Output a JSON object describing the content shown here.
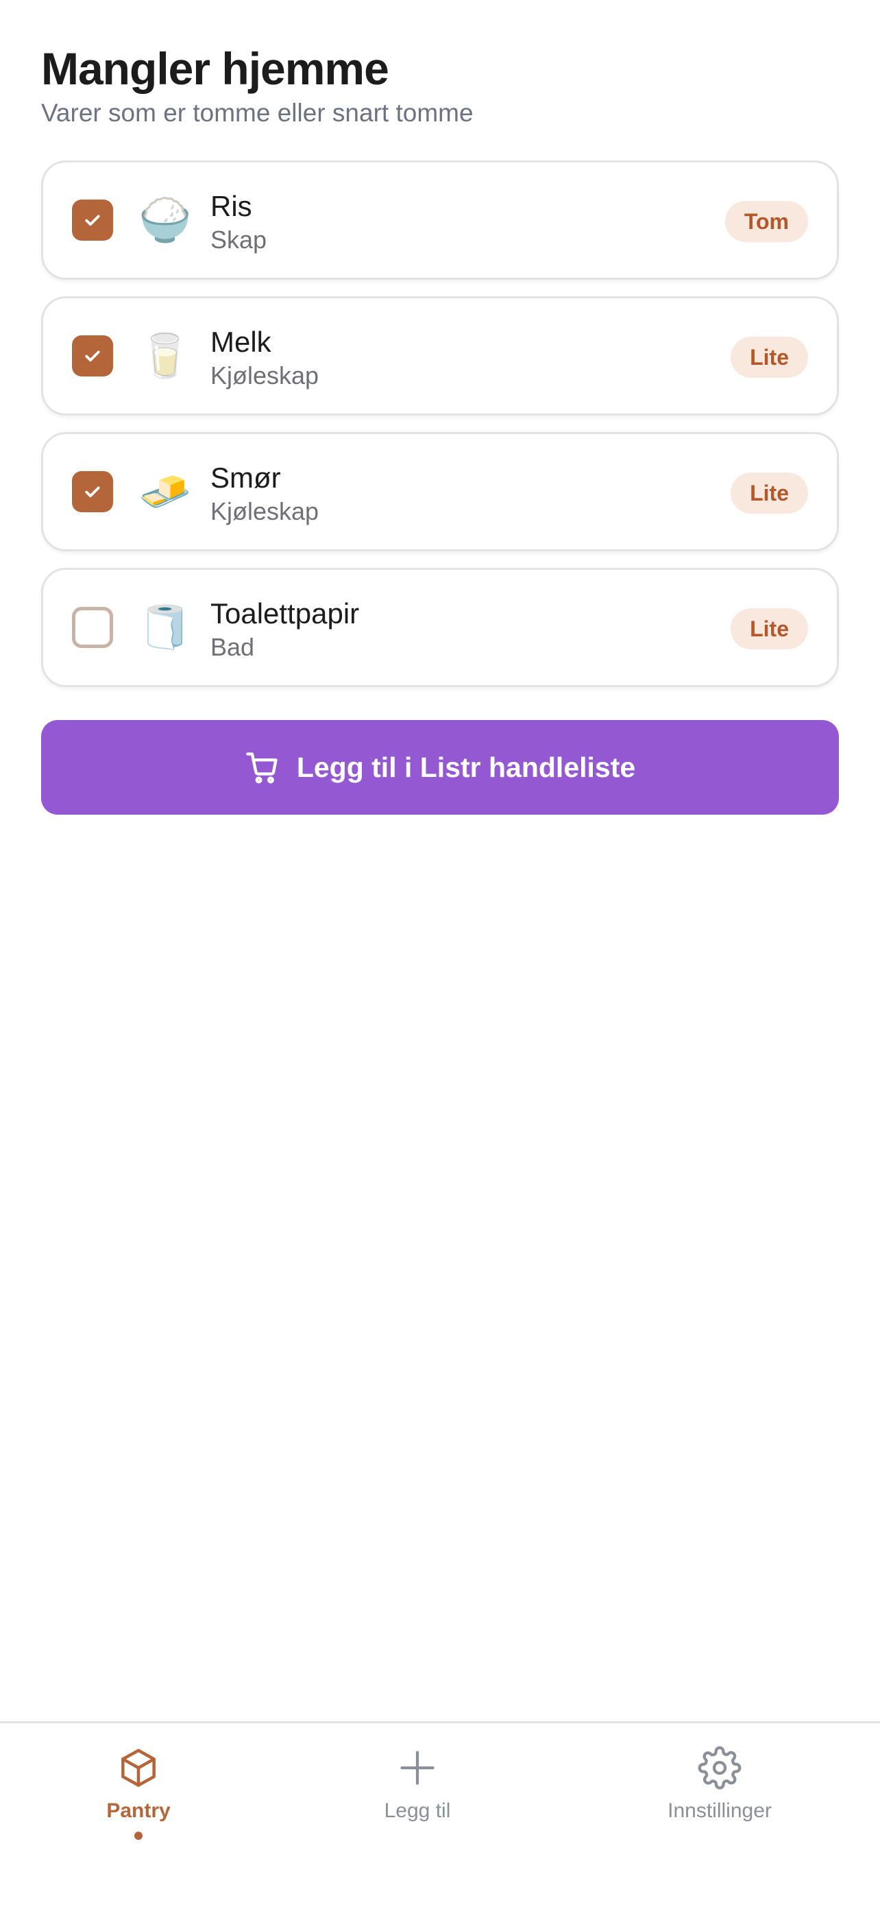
{
  "header": {
    "title": "Mangler hjemme",
    "subtitle": "Varer som er tomme eller snart tomme"
  },
  "items": [
    {
      "name": "Ris",
      "location": "Skap",
      "status": "Tom",
      "checked": true,
      "emoji": "🍚"
    },
    {
      "name": "Melk",
      "location": "Kjøleskap",
      "status": "Lite",
      "checked": true,
      "emoji": "🥛"
    },
    {
      "name": "Smør",
      "location": "Kjøleskap",
      "status": "Lite",
      "checked": true,
      "emoji": "🧈"
    },
    {
      "name": "Toalettpapir",
      "location": "Bad",
      "status": "Lite",
      "checked": false,
      "emoji": "🧻"
    }
  ],
  "cta": {
    "label": "Legg til i Listr handleliste",
    "icon": "cart-icon"
  },
  "tabbar": {
    "tabs": [
      {
        "label": "Pantry",
        "icon": "box-icon",
        "active": true
      },
      {
        "label": "Legg til",
        "icon": "plus-icon",
        "active": false
      },
      {
        "label": "Innstillinger",
        "icon": "gear-icon",
        "active": false
      }
    ]
  },
  "colors": {
    "accent": "#b4663a",
    "cta": "#9459d2",
    "badge_bg": "#f9e8de",
    "badge_text": "#b4582c"
  }
}
